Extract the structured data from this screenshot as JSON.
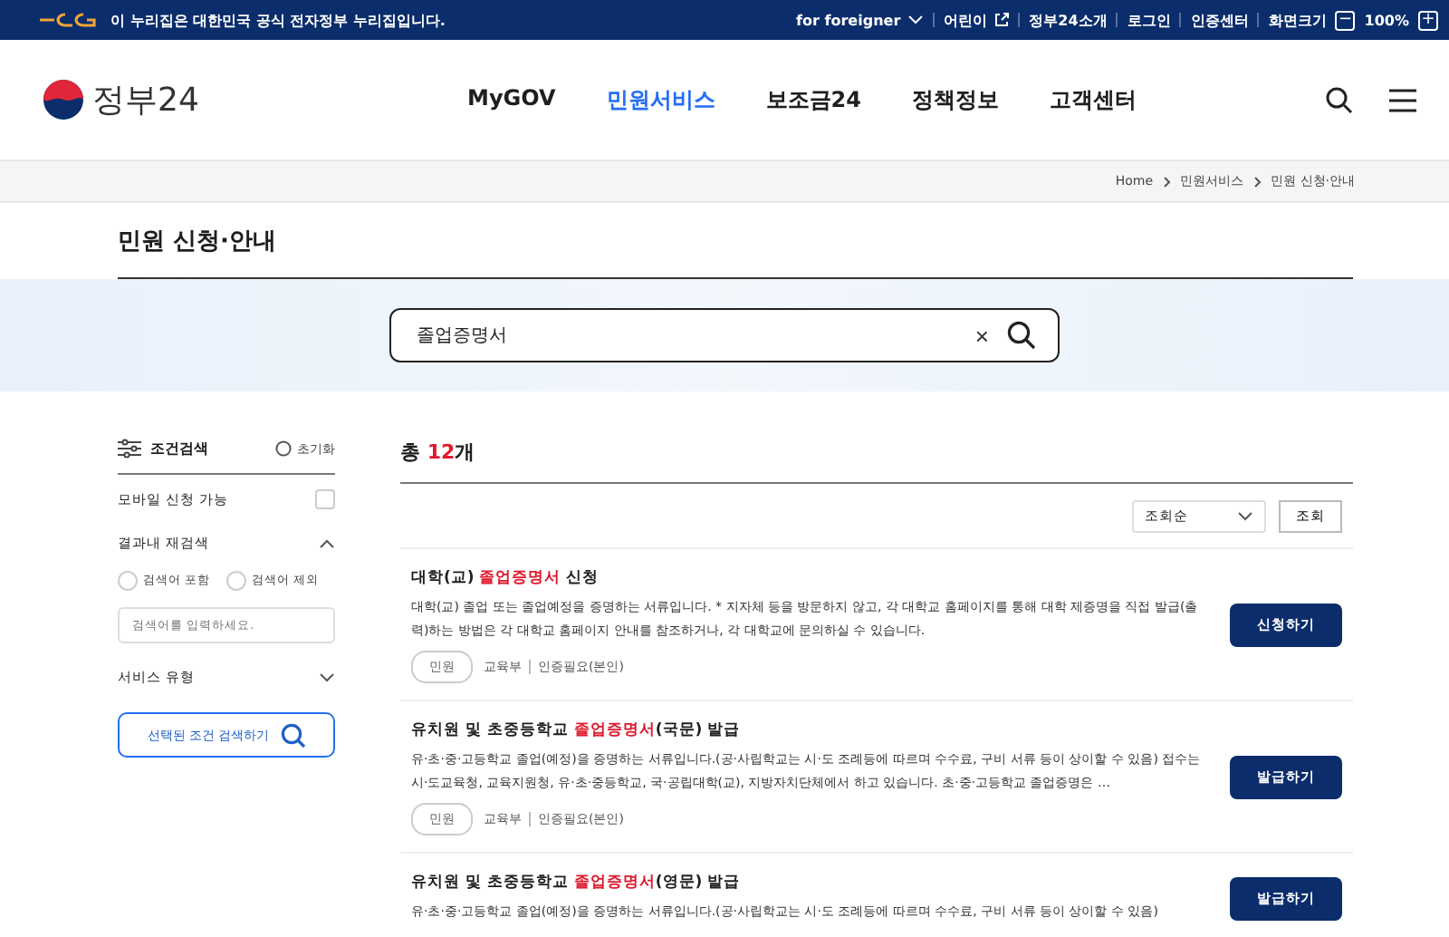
{
  "top_bar": {
    "notice": "이 누리집은 대한민국 공식 전자정부 누리집입니다.",
    "links": [
      {
        "label": "for foreigner",
        "kind": "dropdown"
      },
      {
        "label": "어린이",
        "kind": "external"
      },
      {
        "label": "정부24소개",
        "kind": "plain"
      },
      {
        "label": "로그인",
        "kind": "plain"
      },
      {
        "label": "인증센터",
        "kind": "plain"
      }
    ],
    "zoom_label": "화면크기",
    "zoom_minus": "−",
    "zoom_value": "100%",
    "zoom_plus": "+"
  },
  "header": {
    "logo_text": "정부24",
    "nav": [
      {
        "label": "MyGOV",
        "selected": false
      },
      {
        "label": "민원서비스",
        "selected": true
      },
      {
        "label": "보조금24",
        "selected": false
      },
      {
        "label": "정책정보",
        "selected": false
      },
      {
        "label": "고객센터",
        "selected": false
      }
    ]
  },
  "breadcrumb": [
    "Home",
    "민원서비스",
    "민원 신청·안내"
  ],
  "page_title": "민원 신청·안내",
  "search": {
    "value": "졸업증명서",
    "clear": "×"
  },
  "filters": {
    "title": "조건검색",
    "reset": "초기화",
    "mobile_label": "모바일 신청 가능",
    "mobile_checked": false,
    "research": {
      "label": "결과내 재검색",
      "expanded": true,
      "options": [
        {
          "label": "검색어 포함",
          "selected": false
        },
        {
          "label": "검색어 제외",
          "selected": false
        }
      ],
      "placeholder": "검색어를 입력하세요."
    },
    "service_type": {
      "label": "서비스 유형",
      "expanded": false
    },
    "submit": "선택된 조건 검색하기"
  },
  "results": {
    "total_parts": [
      {
        "text": "총 ",
        "highlight": false
      },
      {
        "text": "12",
        "highlight": true
      },
      {
        "text": "개",
        "highlight": false
      }
    ],
    "sort": "조회순",
    "sort_button": "조회",
    "items": [
      {
        "title_parts": [
          {
            "text": "대학(교) ",
            "highlight": false
          },
          {
            "text": "졸업증명서",
            "highlight": true
          },
          {
            "text": " 신청",
            "highlight": false
          }
        ],
        "description": "대학(교) 졸업 또는 졸업예정을 증명하는 서류입니다. * 지자체 등을 방문하지 않고, 각 대학교 홈페이지를 통해 대학 제증명을 직접 발급(출력)하는 방법은 각 대학교 홈페이지 안내를 참조하거나, 각 대학교에 문의하실 수 있습니다.",
        "tag": "민원",
        "agency": "교육부",
        "auth": "인증필요(본인)",
        "action": "신청하기"
      },
      {
        "title_parts": [
          {
            "text": "유치원 및 초중등학교 ",
            "highlight": false
          },
          {
            "text": "졸업증명서",
            "highlight": true
          },
          {
            "text": "(국문) 발급",
            "highlight": false
          }
        ],
        "description": "유·초·중·고등학교 졸업(예정)을 증명하는 서류입니다.(공·사립학교는 시·도 조례등에 따르며 수수료, 구비 서류 등이 상이할 수 있음) 접수는 시·도교육청, 교육지원청, 유·초·중등학교, 국·공립대학(교), 지방자치단체에서 하고 있습니다. 초·중·고등학교 졸업증명은 …",
        "tag": "민원",
        "agency": "교육부",
        "auth": "인증필요(본인)",
        "action": "발급하기"
      },
      {
        "title_parts": [
          {
            "text": "유치원 및 초중등학교 ",
            "highlight": false
          },
          {
            "text": "졸업증명서",
            "highlight": true
          },
          {
            "text": "(영문) 발급",
            "highlight": false
          }
        ],
        "description": "유·초·중·고등학교 졸업(예정)을 증명하는 서류입니다.(공·사립학교는 시·도 조례등에 따르며 수수료, 구비 서류 등이 상이할 수 있음)",
        "action": "발급하기"
      }
    ]
  }
}
